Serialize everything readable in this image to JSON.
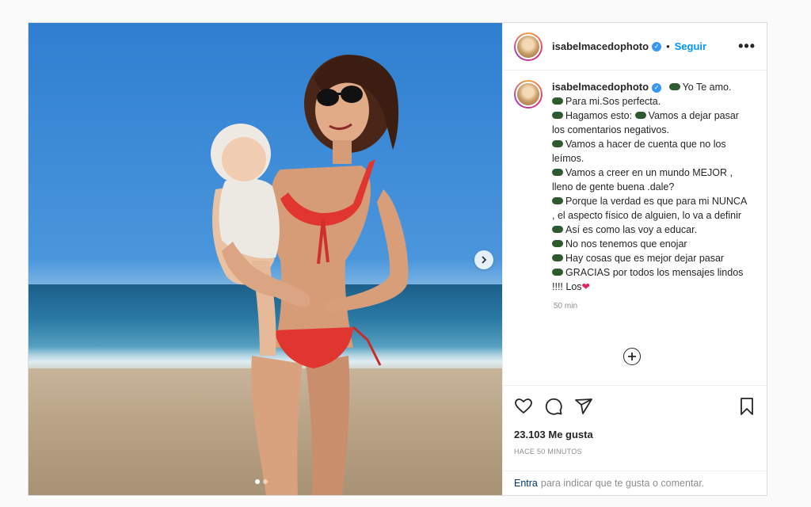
{
  "post": {
    "username": "isabelmacedophoto",
    "follow_label": "Seguir",
    "separator": "•",
    "more_label": "•••"
  },
  "caption": {
    "username": "isabelmacedophoto",
    "lines": [
      "Yo Te amo.",
      "Para mi.Sos perfecta.",
      "Hagamos esto:",
      "Vamos a dejar pasar los comentarios negativos.",
      "Vamos a hacer de cuenta que no los leímos.",
      "Vamos a creer en un mundo MEJOR , lleno de gente buena .dale?",
      "Porque la verdad es que para mi NUNCA , el aspecto físico de alguien, lo va a definir",
      "Así es como las voy a educar.",
      "No nos tenemos que enojar",
      "Hay cosas que es mejor dejar pasar",
      "GRACIAS por todos los mensajes lindos !!!! Los"
    ],
    "time": "50 min"
  },
  "actions": {
    "likes": "23.103 Me gusta",
    "posted_ago": "HACE 50 MINUTOS"
  },
  "footer": {
    "link_label": "Entra",
    "text": "para indicar que te gusta o comentar."
  },
  "colors": {
    "link": "#0095f6",
    "verified": "#3897f0",
    "heart": "#e0245e"
  },
  "icons": [
    "chevron-right-icon",
    "verified-icon",
    "plus-circle-icon",
    "heart-icon",
    "comment-icon",
    "share-icon",
    "bookmark-icon"
  ]
}
